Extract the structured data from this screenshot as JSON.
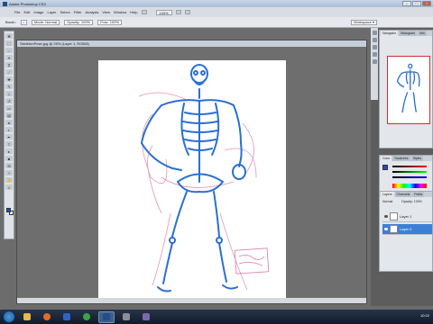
{
  "window": {
    "title": "Adobe Photoshop CS3",
    "controls": [
      "–",
      "□",
      "×"
    ]
  },
  "menu": {
    "items": [
      "File",
      "Edit",
      "Image",
      "Layer",
      "Select",
      "Filter",
      "Analysis",
      "View",
      "Window",
      "Help"
    ],
    "zoom_value": "100%"
  },
  "options_bar": {
    "brush_label": "Brush:",
    "mode_label": "Mode: Normal",
    "opacity_label": "Opacity: 100%",
    "flow_label": "Flow: 100%",
    "workspace_label": "Workspace ▾"
  },
  "document": {
    "tab_title": "SkeletonPose.jpg @ 25% (Layer 1, RGB/8)"
  },
  "panels": {
    "navigator": {
      "tabs": [
        "Navigator",
        "Histogram",
        "Info"
      ]
    },
    "color": {
      "tabs": [
        "Color",
        "Swatches",
        "Styles"
      ]
    },
    "layers": {
      "tabs": [
        "Layers",
        "Channels",
        "Paths"
      ],
      "blend_mode": "Normal",
      "opacity": "Opacity: 100%",
      "rows": [
        {
          "name": "Layer 1"
        },
        {
          "name": "Layer 0"
        }
      ]
    }
  },
  "taskbar": {
    "clock": "10:22"
  },
  "colors": {
    "foreground": "#1a4fd0",
    "background": "#ffffff",
    "sketch_blue": "#2a6fd4",
    "sketch_pink": "#d97aa6"
  },
  "icons": [
    "photoshop-icon",
    "eye-icon",
    "windows-start-icon",
    "explorer-icon",
    "media-icon"
  ]
}
